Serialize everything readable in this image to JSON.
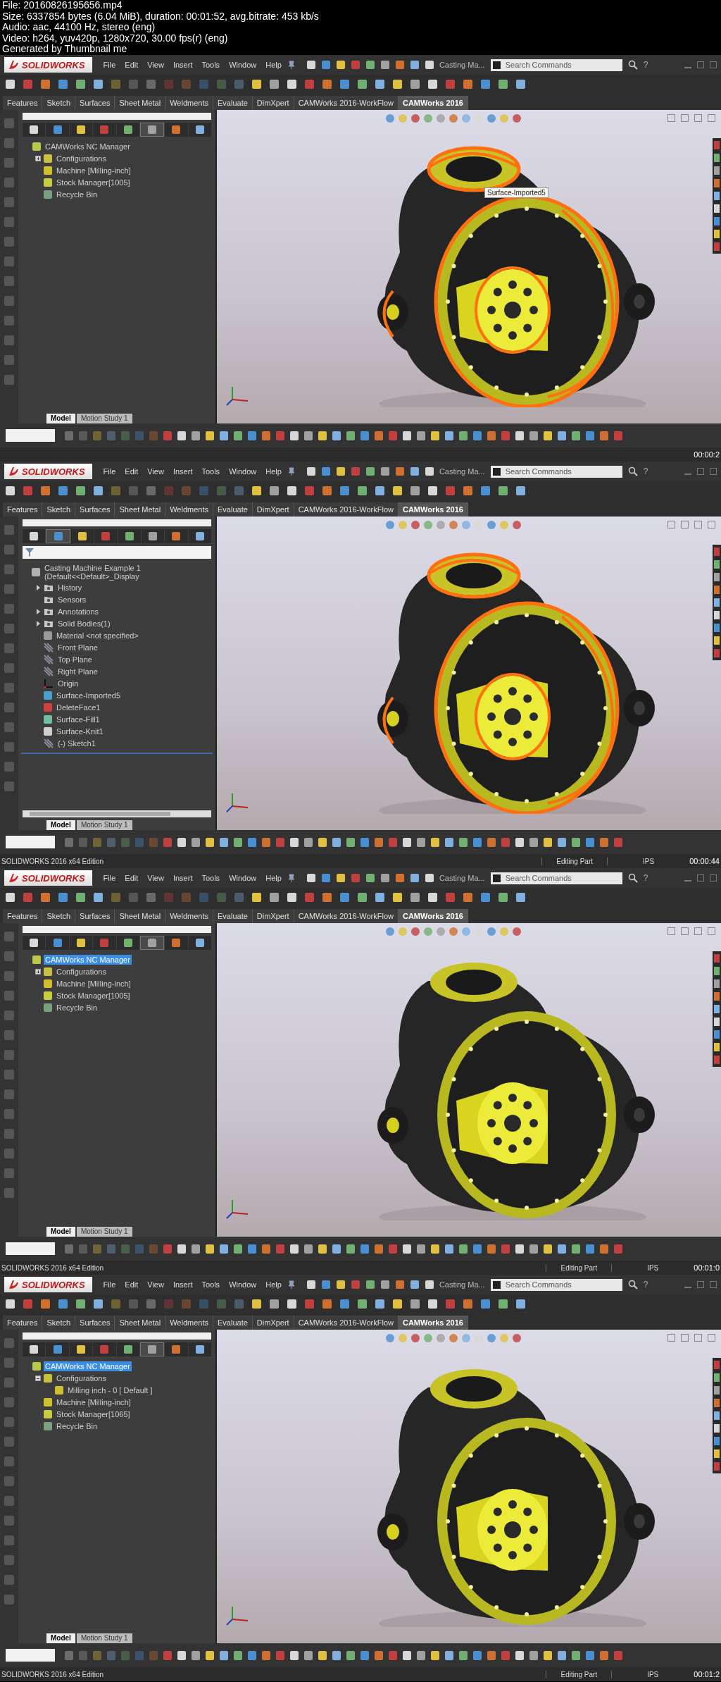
{
  "file_info": [
    "File: 20160826195656.mp4",
    "Size: 6337854 bytes (6.04 MiB), duration: 00:01:52, avg.bitrate: 453 kb/s",
    "Audio: aac, 44100 Hz, stereo (eng)",
    "Video: h264, yuv420p, 1280x720, 30.00 fps(r) (eng)",
    "Generated by Thumbnail me"
  ],
  "frames": [
    {
      "logo": "SOLIDWORKS",
      "menu": [
        "File",
        "Edit",
        "View",
        "Insert",
        "Tools",
        "Window",
        "Help"
      ],
      "doc_title": "Casting Ma...",
      "search": {
        "placeholder": "Search Commands"
      },
      "help_glyph": "?",
      "command_tabs": [
        {
          "label": "Features",
          "selected": false
        },
        {
          "label": "Sketch",
          "selected": false
        },
        {
          "label": "Surfaces",
          "selected": false
        },
        {
          "label": "Sheet Metal",
          "selected": false
        },
        {
          "label": "Weldments",
          "selected": false
        },
        {
          "label": "Evaluate",
          "selected": false
        },
        {
          "label": "DimXpert",
          "selected": false
        },
        {
          "label": "CAMWorks 2016-WorkFlow",
          "selected": false
        },
        {
          "label": "CAMWorks 2016",
          "selected": true
        }
      ],
      "panel_tabs": [
        {
          "selected": false
        },
        {
          "selected": false
        },
        {
          "selected": false
        },
        {
          "selected": false
        },
        {
          "selected": false
        },
        {
          "selected": true
        },
        {
          "selected": false
        },
        {
          "selected": false
        }
      ],
      "filter_bar": false,
      "tree": [
        {
          "label": "CAMWorks NC Manager",
          "kind": "manager",
          "selected": false,
          "children": [
            {
              "label": "Configurations",
              "kind": "config",
              "selected": false,
              "expanded": false
            },
            {
              "label": "Machine [Milling-inch]",
              "kind": "machine",
              "selected": false
            },
            {
              "label": "Stock Manager[1005]",
              "kind": "stock",
              "selected": false
            },
            {
              "label": "Recycle Bin",
              "kind": "recycle",
              "selected": false
            }
          ]
        }
      ],
      "bottom_tabs": [
        {
          "label": "Model",
          "selected": true
        },
        {
          "label": "Motion Study 1",
          "selected": false
        }
      ],
      "model": {
        "highlighted": true
      },
      "tooltip": "Surface-Imported5",
      "status_bar": {
        "time": "00:00:2"
      }
    },
    {
      "logo": "SOLIDWORKS",
      "menu": [
        "File",
        "Edit",
        "View",
        "Insert",
        "Tools",
        "Window",
        "Help"
      ],
      "doc_title": "Casting Ma...",
      "search": {
        "placeholder": "Search Commands"
      },
      "help_glyph": "?",
      "command_tabs": [
        {
          "label": "Features",
          "selected": false
        },
        {
          "label": "Sketch",
          "selected": false
        },
        {
          "label": "Surfaces",
          "selected": false
        },
        {
          "label": "Sheet Metal",
          "selected": false
        },
        {
          "label": "Weldments",
          "selected": false
        },
        {
          "label": "Evaluate",
          "selected": false
        },
        {
          "label": "DimXpert",
          "selected": false
        },
        {
          "label": "CAMWorks 2016-WorkFlow",
          "selected": false
        },
        {
          "label": "CAMWorks 2016",
          "selected": true
        }
      ],
      "panel_tabs": [
        {
          "selected": false
        },
        {
          "selected": true
        },
        {
          "selected": false
        },
        {
          "selected": false
        },
        {
          "selected": false
        },
        {
          "selected": false
        },
        {
          "selected": false
        },
        {
          "selected": false
        }
      ],
      "filter_bar": true,
      "tree": [
        {
          "label": "Casting Machine Example 1  (Default<<Default>_Display",
          "kind": "part",
          "selected": false,
          "children": [
            {
              "label": "History",
              "kind": "folder",
              "selected": false,
              "expanded": false
            },
            {
              "label": "Sensors",
              "kind": "folder",
              "selected": false
            },
            {
              "label": "Annotations",
              "kind": "folder",
              "selected": false,
              "expanded": false
            },
            {
              "label": "Solid Bodies(1)",
              "kind": "folder",
              "selected": false,
              "expanded": false
            },
            {
              "label": "Material <not specified>",
              "kind": "material",
              "selected": false
            },
            {
              "label": "Front Plane",
              "kind": "plane",
              "selected": false
            },
            {
              "label": "Top Plane",
              "kind": "plane",
              "selected": false
            },
            {
              "label": "Right Plane",
              "kind": "plane",
              "selected": false
            },
            {
              "label": "Origin",
              "kind": "origin",
              "selected": false
            },
            {
              "label": "Surface-Imported5",
              "kind": "surface",
              "selected": false
            },
            {
              "label": "DeleteFace1",
              "kind": "delete",
              "selected": false
            },
            {
              "label": "Surface-Fill1",
              "kind": "fill",
              "selected": false
            },
            {
              "label": "Surface-Knit1",
              "kind": "knit",
              "selected": false
            },
            {
              "label": "(-) Sketch1",
              "kind": "sketch",
              "selected": false
            }
          ]
        }
      ],
      "bottom_tabs": [
        {
          "label": "Model",
          "selected": true
        },
        {
          "label": "Motion Study 1",
          "selected": false
        }
      ],
      "model": {
        "highlighted": true
      },
      "status_bar": {
        "edition": "SOLIDWORKS 2016 x64 Edition",
        "mode": "Editing Part",
        "units": "IPS",
        "time": "00:00:44"
      }
    },
    {
      "logo": "SOLIDWORKS",
      "menu": [
        "File",
        "Edit",
        "View",
        "Insert",
        "Tools",
        "Window",
        "Help"
      ],
      "doc_title": "Casting Ma...",
      "search": {
        "placeholder": "Search Commands"
      },
      "help_glyph": "?",
      "command_tabs": [
        {
          "label": "Features",
          "selected": false
        },
        {
          "label": "Sketch",
          "selected": false
        },
        {
          "label": "Surfaces",
          "selected": false
        },
        {
          "label": "Sheet Metal",
          "selected": false
        },
        {
          "label": "Weldments",
          "selected": false
        },
        {
          "label": "Evaluate",
          "selected": false
        },
        {
          "label": "DimXpert",
          "selected": false
        },
        {
          "label": "CAMWorks 2016-WorkFlow",
          "selected": false
        },
        {
          "label": "CAMWorks 2016",
          "selected": true
        }
      ],
      "panel_tabs": [
        {
          "selected": false
        },
        {
          "selected": false
        },
        {
          "selected": false
        },
        {
          "selected": false
        },
        {
          "selected": false
        },
        {
          "selected": true
        },
        {
          "selected": false
        },
        {
          "selected": false
        }
      ],
      "filter_bar": false,
      "tree": [
        {
          "label": "CAMWorks NC Manager",
          "kind": "manager",
          "selected": true,
          "children": [
            {
              "label": "Configurations",
              "kind": "config",
              "selected": false,
              "expanded": false
            },
            {
              "label": "Machine [Milling-inch]",
              "kind": "machine",
              "selected": false
            },
            {
              "label": "Stock Manager[1005]",
              "kind": "stock",
              "selected": false
            },
            {
              "label": "Recycle Bin",
              "kind": "recycle",
              "selected": false
            }
          ]
        }
      ],
      "bottom_tabs": [
        {
          "label": "Model",
          "selected": true
        },
        {
          "label": "Motion Study 1",
          "selected": false
        }
      ],
      "model": {
        "highlighted": false
      },
      "status_bar": {
        "edition": "SOLIDWORKS 2016 x64 Edition",
        "mode": "Editing Part",
        "units": "IPS",
        "time": "00:01:0"
      }
    },
    {
      "logo": "SOLIDWORKS",
      "menu": [
        "File",
        "Edit",
        "View",
        "Insert",
        "Tools",
        "Window",
        "Help"
      ],
      "doc_title": "Casting Ma...",
      "search": {
        "placeholder": "Search Commands"
      },
      "help_glyph": "?",
      "command_tabs": [
        {
          "label": "Features",
          "selected": false
        },
        {
          "label": "Sketch",
          "selected": false
        },
        {
          "label": "Surfaces",
          "selected": false
        },
        {
          "label": "Sheet Metal",
          "selected": false
        },
        {
          "label": "Weldments",
          "selected": false
        },
        {
          "label": "Evaluate",
          "selected": false
        },
        {
          "label": "DimXpert",
          "selected": false
        },
        {
          "label": "CAMWorks 2016-WorkFlow",
          "selected": false
        },
        {
          "label": "CAMWorks 2016",
          "selected": true
        }
      ],
      "panel_tabs": [
        {
          "selected": false
        },
        {
          "selected": false
        },
        {
          "selected": false
        },
        {
          "selected": false
        },
        {
          "selected": false
        },
        {
          "selected": true
        },
        {
          "selected": false
        },
        {
          "selected": false
        }
      ],
      "filter_bar": false,
      "tree": [
        {
          "label": "CAMWorks NC Manager",
          "kind": "manager",
          "selected": true,
          "children": [
            {
              "label": "Configurations",
              "kind": "config",
              "selected": false,
              "expanded": true,
              "children": [
                {
                  "label": "Milling inch - 0 [ Default ]",
                  "kind": "machine",
                  "selected": false
                }
              ]
            },
            {
              "label": "Machine [Milling-inch]",
              "kind": "machine",
              "selected": false
            },
            {
              "label": "Stock Manager[1065]",
              "kind": "stock",
              "selected": false
            },
            {
              "label": "Recycle Bin",
              "kind": "recycle",
              "selected": false
            }
          ]
        }
      ],
      "bottom_tabs": [
        {
          "label": "Model",
          "selected": true
        },
        {
          "label": "Motion Study 1",
          "selected": false
        }
      ],
      "model": {
        "highlighted": false
      },
      "status_bar": {
        "edition": "SOLIDWORKS 2016 x64 Edition",
        "mode": "Editing Part",
        "units": "IPS",
        "time": "00:01:2"
      }
    }
  ]
}
